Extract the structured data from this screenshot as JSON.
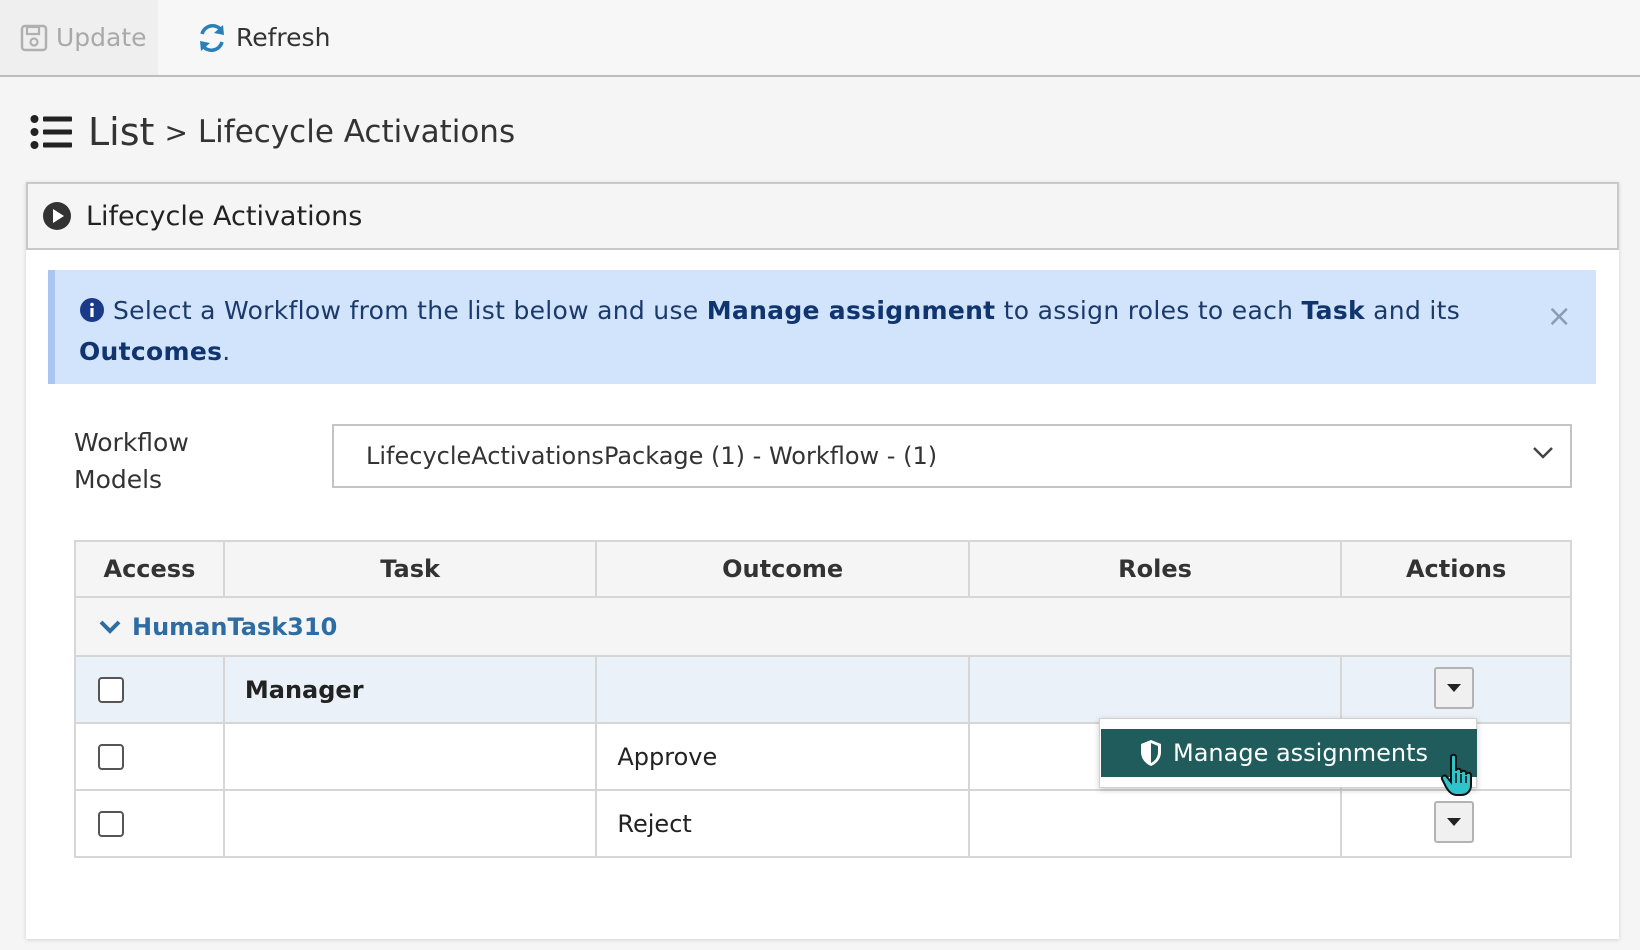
{
  "toolbar": {
    "update_label": "Update",
    "refresh_label": "Refresh"
  },
  "breadcrumb": {
    "root": "List",
    "separator": ">",
    "current": "Lifecycle Activations"
  },
  "panel": {
    "title": "Lifecycle Activations"
  },
  "alert": {
    "text_1": "Select a Workflow from the list below and use ",
    "bold_1": "Manage assignment",
    "text_2": " to assign roles to each ",
    "bold_2": "Task",
    "text_3": " and its ",
    "bold_3": "Outcomes",
    "text_4": ".",
    "close": "×"
  },
  "workflow": {
    "label_line1": "Workflow",
    "label_line2": "Models",
    "selected": "LifecycleActivationsPackage (1) - Workflow - (1)"
  },
  "table": {
    "columns": [
      "Access",
      "Task",
      "Outcome",
      "Roles",
      "Actions"
    ],
    "group": "HumanTask310",
    "rows": [
      {
        "task": "Manager",
        "outcome": "",
        "roles": ""
      },
      {
        "task": "",
        "outcome": "Approve",
        "roles": ""
      },
      {
        "task": "",
        "outcome": "Reject",
        "roles": ""
      }
    ]
  },
  "popup": {
    "item_label": "Manage assignments"
  },
  "colors": {
    "accent_teal": "#205c5c",
    "link_blue": "#2d6da3",
    "alert_bg": "#d2e3fc",
    "task_row_bg": "#ebf1f8"
  }
}
